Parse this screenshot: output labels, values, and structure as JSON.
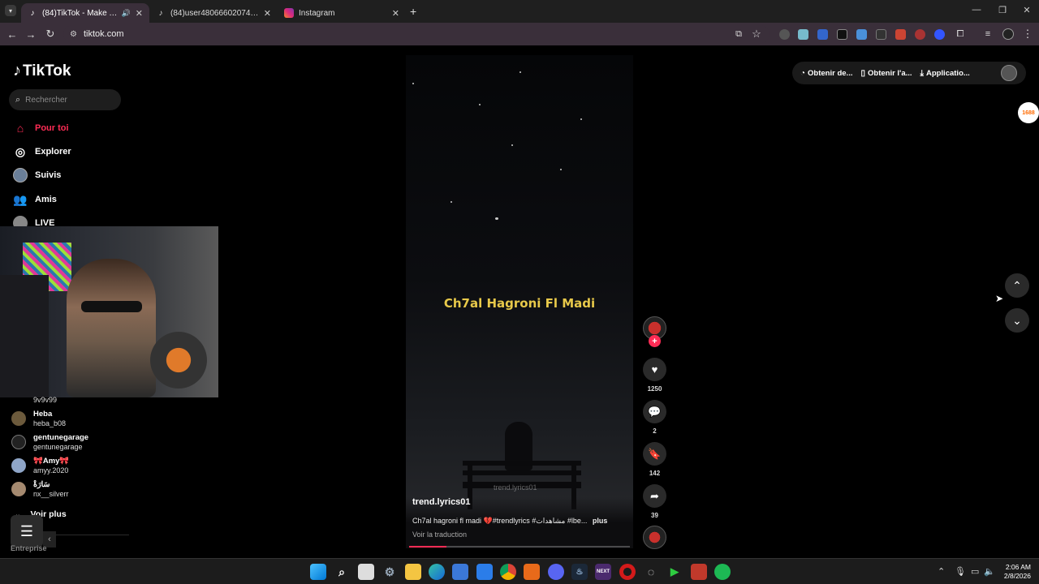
{
  "browser": {
    "tabs": [
      {
        "label": "(84)TikTok - Make Your Day",
        "active": true,
        "icon": "tiktok-icon",
        "audio": true
      },
      {
        "label": "(84)user4806660207417 3 (@kh",
        "active": false,
        "icon": "tiktok-icon"
      },
      {
        "label": "Instagram",
        "active": false,
        "icon": "instagram-icon"
      }
    ],
    "new_tab_glyph": "+",
    "url": "tiktok.com"
  },
  "tiktok": {
    "logo_text": "TikTok",
    "search_placeholder": "Rechercher",
    "nav": [
      {
        "label": "Pour toi",
        "icon": "home-icon",
        "active": true
      },
      {
        "label": "Explorer",
        "icon": "compass-icon"
      },
      {
        "label": "Suivis",
        "icon": "following-avatar-icon"
      },
      {
        "label": "Amis",
        "icon": "friends-icon"
      },
      {
        "label": "LIVE",
        "icon": "live-icon"
      }
    ],
    "following": [
      {
        "name": "",
        "user": "9v9v99"
      },
      {
        "name": "Heba",
        "user": "heba_b08"
      },
      {
        "name": "gentunegarage",
        "user": "gentunegarage"
      },
      {
        "name": "🎀Amy🎀",
        "user": "amyy.2020"
      },
      {
        "name": "سَارَةْ",
        "user": "nx__silverr"
      }
    ],
    "voir_plus": "Voir plus",
    "entreprise": "Entreprise",
    "top_right": {
      "item1": "Obtenir de...",
      "item2": "Obtenir l'a...",
      "item3": "Applicatio..."
    },
    "ali_badge": "1688"
  },
  "video": {
    "lyric_text": "Ch7al Hagroni Fl Madi",
    "watermark": "trend.lyrics01",
    "author": "trend.lyrics01",
    "caption": "Ch7al hagroni fl madi 💔#trendlyrics #مشاهدات #lbe...",
    "more": "plus",
    "translate": "Voir la traduction",
    "progress": 0.17
  },
  "actions": {
    "likes": "1250",
    "comments": "2",
    "saves": "142",
    "shares": "39"
  },
  "taskbar": {
    "time": "2:06 AM",
    "date": "2/8/2026"
  },
  "colors": {
    "accent": "#fe2c55",
    "lyric": "#e8c94a",
    "tab_active": "#3a2f3a"
  }
}
